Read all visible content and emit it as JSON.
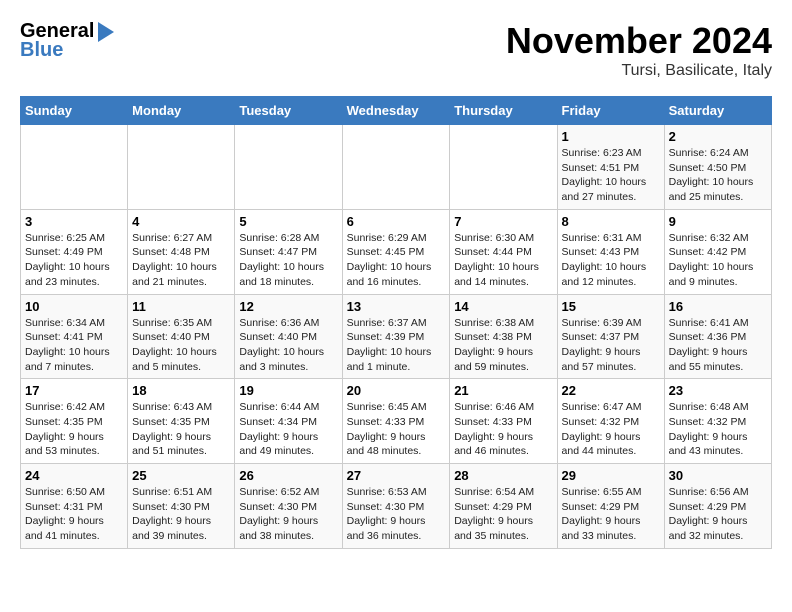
{
  "header": {
    "logo_line1": "General",
    "logo_line2": "Blue",
    "month": "November 2024",
    "location": "Tursi, Basilicate, Italy"
  },
  "weekdays": [
    "Sunday",
    "Monday",
    "Tuesday",
    "Wednesday",
    "Thursday",
    "Friday",
    "Saturday"
  ],
  "weeks": [
    [
      {
        "day": "",
        "info": ""
      },
      {
        "day": "",
        "info": ""
      },
      {
        "day": "",
        "info": ""
      },
      {
        "day": "",
        "info": ""
      },
      {
        "day": "",
        "info": ""
      },
      {
        "day": "1",
        "info": "Sunrise: 6:23 AM\nSunset: 4:51 PM\nDaylight: 10 hours and 27 minutes."
      },
      {
        "day": "2",
        "info": "Sunrise: 6:24 AM\nSunset: 4:50 PM\nDaylight: 10 hours and 25 minutes."
      }
    ],
    [
      {
        "day": "3",
        "info": "Sunrise: 6:25 AM\nSunset: 4:49 PM\nDaylight: 10 hours and 23 minutes."
      },
      {
        "day": "4",
        "info": "Sunrise: 6:27 AM\nSunset: 4:48 PM\nDaylight: 10 hours and 21 minutes."
      },
      {
        "day": "5",
        "info": "Sunrise: 6:28 AM\nSunset: 4:47 PM\nDaylight: 10 hours and 18 minutes."
      },
      {
        "day": "6",
        "info": "Sunrise: 6:29 AM\nSunset: 4:45 PM\nDaylight: 10 hours and 16 minutes."
      },
      {
        "day": "7",
        "info": "Sunrise: 6:30 AM\nSunset: 4:44 PM\nDaylight: 10 hours and 14 minutes."
      },
      {
        "day": "8",
        "info": "Sunrise: 6:31 AM\nSunset: 4:43 PM\nDaylight: 10 hours and 12 minutes."
      },
      {
        "day": "9",
        "info": "Sunrise: 6:32 AM\nSunset: 4:42 PM\nDaylight: 10 hours and 9 minutes."
      }
    ],
    [
      {
        "day": "10",
        "info": "Sunrise: 6:34 AM\nSunset: 4:41 PM\nDaylight: 10 hours and 7 minutes."
      },
      {
        "day": "11",
        "info": "Sunrise: 6:35 AM\nSunset: 4:40 PM\nDaylight: 10 hours and 5 minutes."
      },
      {
        "day": "12",
        "info": "Sunrise: 6:36 AM\nSunset: 4:40 PM\nDaylight: 10 hours and 3 minutes."
      },
      {
        "day": "13",
        "info": "Sunrise: 6:37 AM\nSunset: 4:39 PM\nDaylight: 10 hours and 1 minute."
      },
      {
        "day": "14",
        "info": "Sunrise: 6:38 AM\nSunset: 4:38 PM\nDaylight: 9 hours and 59 minutes."
      },
      {
        "day": "15",
        "info": "Sunrise: 6:39 AM\nSunset: 4:37 PM\nDaylight: 9 hours and 57 minutes."
      },
      {
        "day": "16",
        "info": "Sunrise: 6:41 AM\nSunset: 4:36 PM\nDaylight: 9 hours and 55 minutes."
      }
    ],
    [
      {
        "day": "17",
        "info": "Sunrise: 6:42 AM\nSunset: 4:35 PM\nDaylight: 9 hours and 53 minutes."
      },
      {
        "day": "18",
        "info": "Sunrise: 6:43 AM\nSunset: 4:35 PM\nDaylight: 9 hours and 51 minutes."
      },
      {
        "day": "19",
        "info": "Sunrise: 6:44 AM\nSunset: 4:34 PM\nDaylight: 9 hours and 49 minutes."
      },
      {
        "day": "20",
        "info": "Sunrise: 6:45 AM\nSunset: 4:33 PM\nDaylight: 9 hours and 48 minutes."
      },
      {
        "day": "21",
        "info": "Sunrise: 6:46 AM\nSunset: 4:33 PM\nDaylight: 9 hours and 46 minutes."
      },
      {
        "day": "22",
        "info": "Sunrise: 6:47 AM\nSunset: 4:32 PM\nDaylight: 9 hours and 44 minutes."
      },
      {
        "day": "23",
        "info": "Sunrise: 6:48 AM\nSunset: 4:32 PM\nDaylight: 9 hours and 43 minutes."
      }
    ],
    [
      {
        "day": "24",
        "info": "Sunrise: 6:50 AM\nSunset: 4:31 PM\nDaylight: 9 hours and 41 minutes."
      },
      {
        "day": "25",
        "info": "Sunrise: 6:51 AM\nSunset: 4:30 PM\nDaylight: 9 hours and 39 minutes."
      },
      {
        "day": "26",
        "info": "Sunrise: 6:52 AM\nSunset: 4:30 PM\nDaylight: 9 hours and 38 minutes."
      },
      {
        "day": "27",
        "info": "Sunrise: 6:53 AM\nSunset: 4:30 PM\nDaylight: 9 hours and 36 minutes."
      },
      {
        "day": "28",
        "info": "Sunrise: 6:54 AM\nSunset: 4:29 PM\nDaylight: 9 hours and 35 minutes."
      },
      {
        "day": "29",
        "info": "Sunrise: 6:55 AM\nSunset: 4:29 PM\nDaylight: 9 hours and 33 minutes."
      },
      {
        "day": "30",
        "info": "Sunrise: 6:56 AM\nSunset: 4:29 PM\nDaylight: 9 hours and 32 minutes."
      }
    ]
  ]
}
